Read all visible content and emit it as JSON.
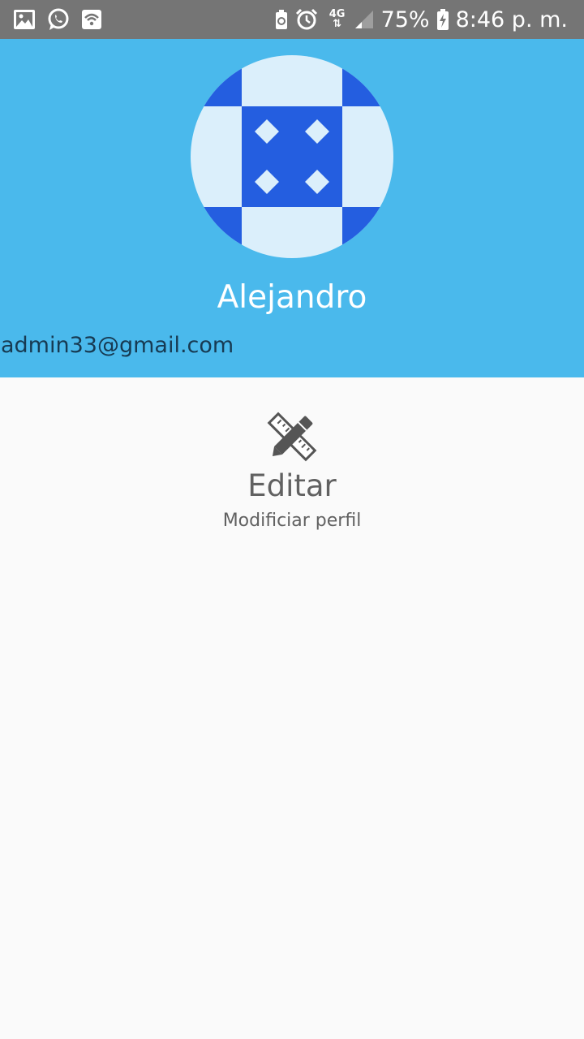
{
  "status_bar": {
    "left_icons": [
      "image-notification-icon",
      "whatsapp-icon",
      "wifi-icon"
    ],
    "right_icons": [
      "battery-saver-icon",
      "alarm-icon",
      "signal-icon",
      "battery-charging-icon"
    ],
    "network_type": "4G",
    "battery_percent": "75%",
    "time": "8:46 p. m."
  },
  "header": {
    "background_color": "#4ab9ec",
    "avatar_icon": "checkerboard-pattern-avatar",
    "user_name": "Alejandro",
    "user_email": "admin33@gmail.com"
  },
  "edit_option": {
    "icon": "ruler-pencil-icon",
    "title": "Editar",
    "subtitle": "Modificiar perfil"
  }
}
